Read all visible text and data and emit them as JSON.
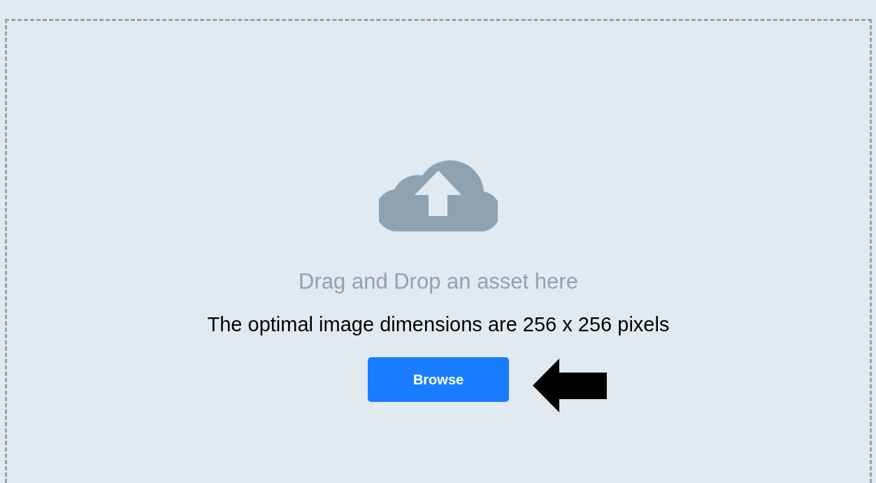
{
  "dropzone": {
    "hint": "Drag and Drop an asset here",
    "note": "The optimal image dimensions are 256 x 256 pixels",
    "button": "Browse"
  }
}
